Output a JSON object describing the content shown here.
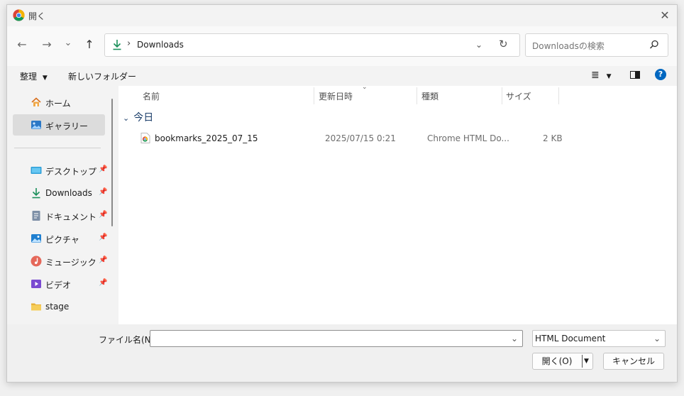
{
  "window": {
    "title": "開く",
    "close_glyph": "✕"
  },
  "navigation": {
    "back_glyph": "←",
    "forward_glyph": "→",
    "recent_glyph": "⌄",
    "up_glyph": "↑",
    "breadcrumb_separator": "›",
    "path": "Downloads",
    "refresh_glyph": "↻",
    "search_placeholder": "Downloadsの検索"
  },
  "commandbar": {
    "organize": "整理",
    "new_folder": "新しいフォルダー"
  },
  "sidebar": {
    "items": [
      {
        "label": "ホーム",
        "icon": "home-icon",
        "pinned": false
      },
      {
        "label": "ギャラリー",
        "icon": "gallery-icon",
        "pinned": false,
        "selected": true
      },
      {
        "label": "デスクトップ",
        "icon": "desktop-icon",
        "pinned": true
      },
      {
        "label": "Downloads",
        "icon": "download-icon",
        "pinned": true
      },
      {
        "label": "ドキュメント",
        "icon": "document-icon",
        "pinned": true
      },
      {
        "label": "ピクチャ",
        "icon": "pictures-icon",
        "pinned": true
      },
      {
        "label": "ミュージック",
        "icon": "music-icon",
        "pinned": true
      },
      {
        "label": "ビデオ",
        "icon": "video-icon",
        "pinned": true
      },
      {
        "label": "stage",
        "icon": "folder-icon",
        "pinned": false
      }
    ]
  },
  "filelist": {
    "columns": [
      "名前",
      "更新日時",
      "種類",
      "サイズ"
    ],
    "groups": [
      {
        "name": "今日",
        "files": [
          {
            "name": "bookmarks_2025_07_15",
            "modified": "2025/07/15 0:21",
            "type": "Chrome HTML Do...",
            "size": "2 KB",
            "icon": "chrome-html-file-icon"
          }
        ]
      }
    ]
  },
  "footer": {
    "filename_label": "ファイル名(N):",
    "filename_value": "",
    "filetype": "HTML Document",
    "open_button": "開く(O)",
    "cancel_button": "キャンセル"
  },
  "colors": {
    "accent": "#0067c0",
    "download_green": "#1a8f5a",
    "folder_yellow": "#f2c44d"
  }
}
